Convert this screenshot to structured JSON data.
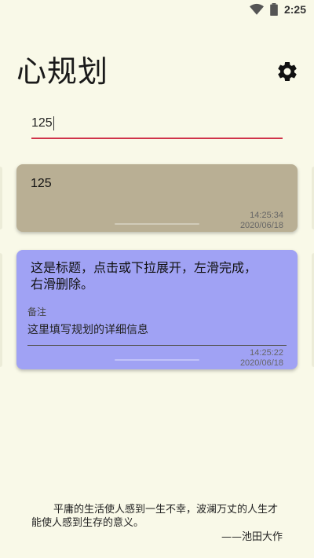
{
  "status_bar": {
    "time": "2:25",
    "icons": [
      "wifi-icon",
      "battery-icon"
    ]
  },
  "header": {
    "title": "心规划",
    "settings_icon": "gear-icon"
  },
  "search": {
    "value": "125",
    "accent_color": "#d0334a"
  },
  "cards": [
    {
      "title": "125",
      "time": "14:25:34",
      "date": "2020/06/18",
      "color": "#b9af94"
    },
    {
      "title": "这是标题，点击或下拉展开，左滑完成，右滑删除。",
      "note_label": "备注",
      "note": "这里填写规划的详细信息",
      "time": "14:25:22",
      "date": "2020/06/18",
      "color": "#a0a2f4"
    }
  ],
  "footer": {
    "quote": "平庸的生活使人感到一生不幸，波澜万丈的人生才能使人感到生存的意义。",
    "author": "——池田大作"
  }
}
